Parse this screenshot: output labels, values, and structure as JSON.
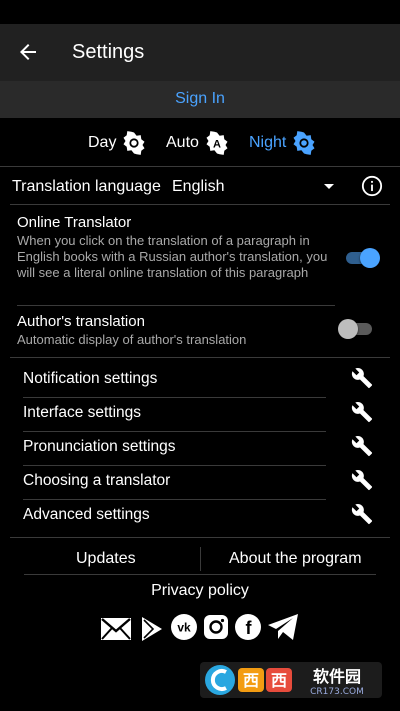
{
  "header": {
    "title": "Settings",
    "back_icon": "arrow-back-icon"
  },
  "signin": {
    "label": "Sign In",
    "color": "#4aa3ff"
  },
  "theme": {
    "options": [
      {
        "label": "Day",
        "icon": "sun-icon",
        "selected": false
      },
      {
        "label": "Auto",
        "icon": "auto-brightness-icon",
        "selected": false
      },
      {
        "label": "Night",
        "icon": "sun-icon",
        "selected": true
      }
    ],
    "accent": "#4aa3ff"
  },
  "language": {
    "label": "Translation language",
    "value": "English",
    "info_icon": "info-icon"
  },
  "online_translator": {
    "title": "Online Translator",
    "description": "When you click on the translation of a paragraph in English books with a Russian author's translation, you will see a literal online translation of this paragraph",
    "enabled": true
  },
  "authors_translation": {
    "title": "Author's translation",
    "description": "Automatic display of author's translation",
    "enabled": false
  },
  "menu": {
    "items": [
      {
        "label": "Notification settings",
        "icon": "wrench-icon"
      },
      {
        "label": "Interface settings",
        "icon": "wrench-icon"
      },
      {
        "label": "Pronunciation settings",
        "icon": "wrench-icon"
      },
      {
        "label": "Choosing a translator",
        "icon": "wrench-icon"
      },
      {
        "label": "Advanced settings",
        "icon": "wrench-icon"
      }
    ]
  },
  "footer": {
    "updates": "Updates",
    "about": "About the program",
    "privacy": "Privacy policy",
    "social_icons": [
      "mail-icon",
      "google-play-icon",
      "vk-icon",
      "instagram-icon",
      "facebook-icon",
      "telegram-icon"
    ]
  },
  "watermark": {
    "text": "西西软件园",
    "subtext": "CR173.COM"
  }
}
